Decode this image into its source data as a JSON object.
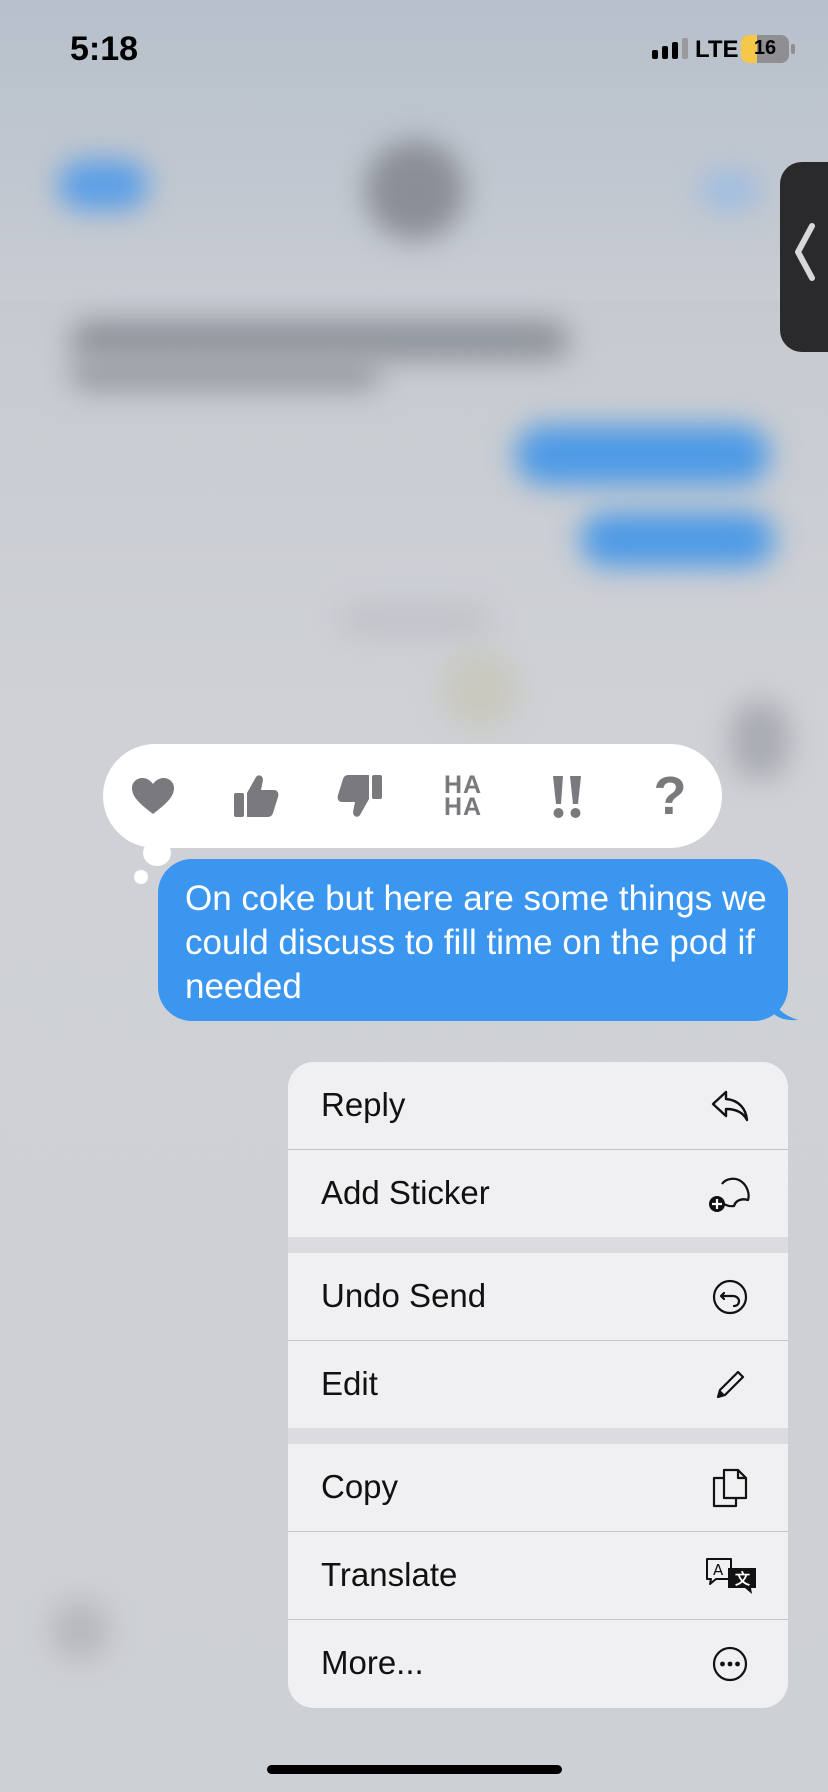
{
  "status_bar": {
    "time": "5:18",
    "network": "LTE",
    "battery": "16"
  },
  "reactions": [
    {
      "name": "heart",
      "label": ""
    },
    {
      "name": "thumbs-up",
      "label": ""
    },
    {
      "name": "thumbs-down",
      "label": ""
    },
    {
      "name": "haha",
      "label_line1": "HA",
      "label_line2": "HA"
    },
    {
      "name": "emphasize",
      "label": "!!"
    },
    {
      "name": "question",
      "label": "?"
    }
  ],
  "message": {
    "text": "On coke but here are some things we could discuss to fill time on the pod if needed",
    "bubble_color": "#3b96f0"
  },
  "menu": {
    "items": [
      {
        "label": "Reply",
        "icon": "reply-icon"
      },
      {
        "label": "Add Sticker",
        "icon": "add-sticker-icon"
      },
      {
        "label": "Undo Send",
        "icon": "undo-send-icon"
      },
      {
        "label": "Edit",
        "icon": "edit-pencil-icon"
      },
      {
        "label": "Copy",
        "icon": "copy-icon"
      },
      {
        "label": "Translate",
        "icon": "translate-icon"
      },
      {
        "label": "More...",
        "icon": "more-ellipsis-icon"
      }
    ]
  },
  "colors": {
    "accent": "#3b96f0",
    "reaction_icon": "#7a7a7e",
    "menu_background": "#f0f0f2"
  }
}
